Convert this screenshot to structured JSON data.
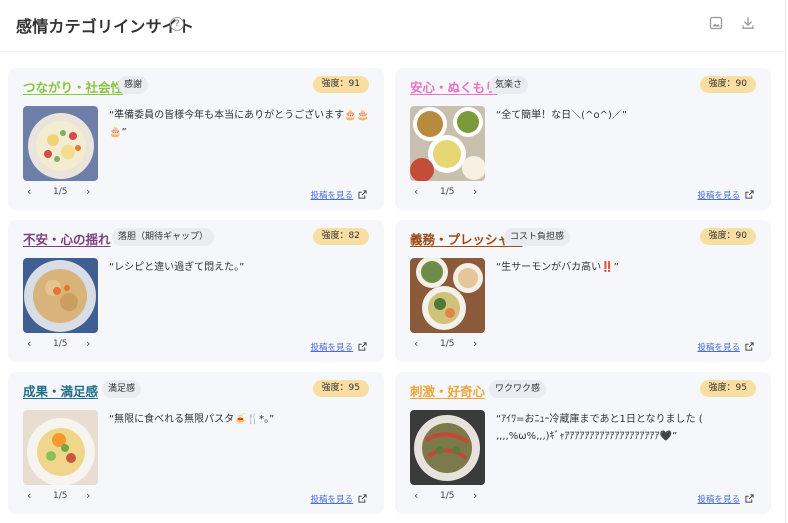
{
  "header": {
    "title": "感情カテゴリインサイト",
    "help_icon": "question-circle-icon",
    "help_glyph": "?",
    "actions": [
      "image-icon",
      "download-icon"
    ]
  },
  "pager": {
    "prev": "‹",
    "next": "›"
  },
  "link_label": "投稿を見る",
  "cards": [
    {
      "category": "つながり・社会性",
      "color": "#8cc63f",
      "tag": "感謝",
      "strength": "強度：91",
      "quote": "“準備委員の皆様今年も本当にありがとうございます🎂🎂🎂”",
      "page": "1/5"
    },
    {
      "category": "安心・ぬくもり",
      "color": "#e873c8",
      "tag": "気楽さ",
      "strength": "強度：90",
      "quote": "“全て簡単！な日＼(^o^)／”",
      "page": "1/5"
    },
    {
      "category": "不安・心の揺れ",
      "color": "#7e3f7e",
      "tag": "落胆（期待ギャップ）",
      "strength": "強度：82",
      "quote": "“レシピと違い過ぎて悶えた。”",
      "page": "1/5"
    },
    {
      "category": "義務・プレッシャー",
      "color": "#9c4a14",
      "tag": "コスト負担感",
      "strength": "強度：90",
      "quote": "“生サーモンがバカ高い‼️”",
      "page": "1/5"
    },
    {
      "category": "成果・満足感",
      "color": "#1f6e8c",
      "tag": "満足感",
      "strength": "強度：95",
      "quote": "“無限に食べれる無限パスタ🍝🍴*。”",
      "page": "1/5"
    },
    {
      "category": "刺激・好奇心",
      "color": "#f0a63a",
      "tag": "ワクワク感",
      "strength": "強度：95",
      "quote": "“ｱｲﾜ=おﾆｭｰ冷蔵庫まであと1日となりました ( ,,,,%ω%,,,)ｷﾞｬｱｱｱｱｱｱｱｱｱｱｱｱｱｱｱｱｱｱｱ🖤”",
      "page": "1/5"
    }
  ]
}
